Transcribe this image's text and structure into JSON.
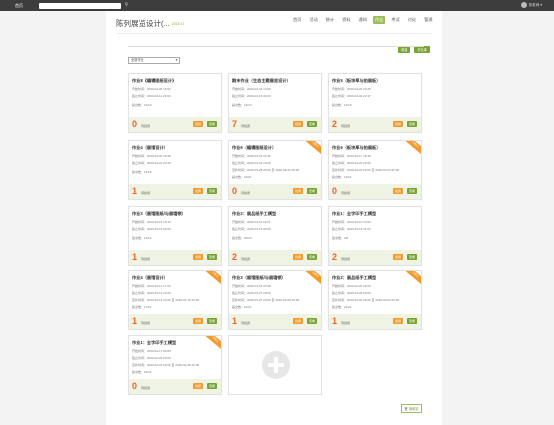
{
  "topbar": {
    "home": "首页",
    "user": "张老师 ▾"
  },
  "course": {
    "title": "陈列展览设计(...",
    "subtitle": "2018 17"
  },
  "nav": [
    "首页",
    "活动",
    "统计",
    "资料",
    "通知",
    "作业",
    "考试",
    "讨论",
    "管理"
  ],
  "nav_active": 5,
  "actions": {
    "create": "新建",
    "library": "作业库"
  },
  "filter": {
    "selected": "全部作业"
  },
  "labels": {
    "unreviewed": "待批阅",
    "review": "批阅",
    "view": "查看",
    "ribbon": "已截止",
    "recycle": "回收站"
  },
  "cards": [
    {
      "title": "作业8《编辑图纸设计》",
      "start": "开始时间：2020-04-06 15:02",
      "end": "截止时间：2020-04-11 23:00",
      "submitted": "提交数：16/13",
      "count": "0"
    },
    {
      "title": "期末作业（生态主题展览设计）",
      "start": "开始时间：2020-03-31 14:09",
      "end": "截止时间：2020-04-15 00:00",
      "submitted": "提交数：13/13",
      "count": "7"
    },
    {
      "title": "作业5（板块草与拍展板）",
      "start": "开始时间：2020-03-26 23:29",
      "end": "截止时间：2020-04-02 22:37",
      "submitted": "提交数：12/15",
      "count": "2"
    },
    {
      "title": "作业4（展馆设计）",
      "start": "开始时间：2020-03-20 23:28",
      "end": "截止时间：2020-03-22 23:25",
      "submitted": "提交数：11/18",
      "count": "1"
    },
    {
      "title": "作业6（编辑图纸设计）",
      "start": "开始时间：2020-03-18 16:49",
      "end": "截止时间：2020-03-22 10:00",
      "submitted": "提交数：10/21",
      "count": "0",
      "extra": "至补时间：2020-03-28 20:00 至 2020-03-29 20:00",
      "ribbon": true
    },
    {
      "title": "作业5（板块草与拍展板）",
      "start": "开始时间：2020-03-17 15:49",
      "end": "截止时间：2020-03-22 20:00",
      "submitted": "提交数：13/21",
      "count": "0",
      "extra": "至补时间：2020-03-22 20:00 至 2020-03-23 20:00",
      "ribbon": true
    },
    {
      "title": "作业3（展馆图纸/与展墙顿）",
      "start": "开始时间：2020-03-13 19:12",
      "end": "截止时间：2020-03-15 00:00",
      "submitted": "提交数：11/12",
      "count": "1"
    },
    {
      "title": "作业2：展品纸手工模型",
      "start": "开始时间：2020-03-11 19:07",
      "end": "截止时间：2020-03-15 00:00",
      "submitted": "提交数：20/10",
      "count": "2"
    },
    {
      "title": "作业1：全字印手工模型",
      "start": "开始时间：2020-03-10 10:04",
      "end": "截止时间：2020-03-16 11:00",
      "submitted": "提交数：2/6",
      "count": "2"
    },
    {
      "title": "作业4（展馆设计）",
      "start": "开始时间：2020-03-11 17:02",
      "end": "截止时间：2020-03-13 20:00",
      "submitted": "提交数：17/21",
      "count": "1",
      "extra": "至补时间：2020-03-14 20:00 至 2020-03-15 20:00",
      "ribbon": true
    },
    {
      "title": "作业3（展馆图纸/与展墙顿）",
      "start": "开始时间：2020-03-03 15:08",
      "end": "截止时间：2020-03-07 20:00",
      "submitted": "提交数：16/21",
      "count": "1",
      "extra": "至补时间：2020-03-07 20:00 至 2020-03-08 20:00",
      "ribbon": true
    },
    {
      "title": "作业2：展品纸手工模型",
      "start": "开始时间：2020-02-25 20:00",
      "end": "截止时间：2020-03-28 20:00",
      "submitted": "提交数：21/21",
      "count": "1",
      "extra": "至补时间：2020-03-02 20:00 至 2020-03-03 20:00",
      "ribbon": true
    },
    {
      "title": "作业1：全字印手工模型",
      "start": "开始时间：2020-02-17 00:00",
      "end": "截止时间：2020-02-23 20:00",
      "submitted": "提交数：22/21",
      "count": "0",
      "extra": "至补时间：2020-02-24 20:00 至 2020-02-25 20:00",
      "ribbon": true
    }
  ]
}
